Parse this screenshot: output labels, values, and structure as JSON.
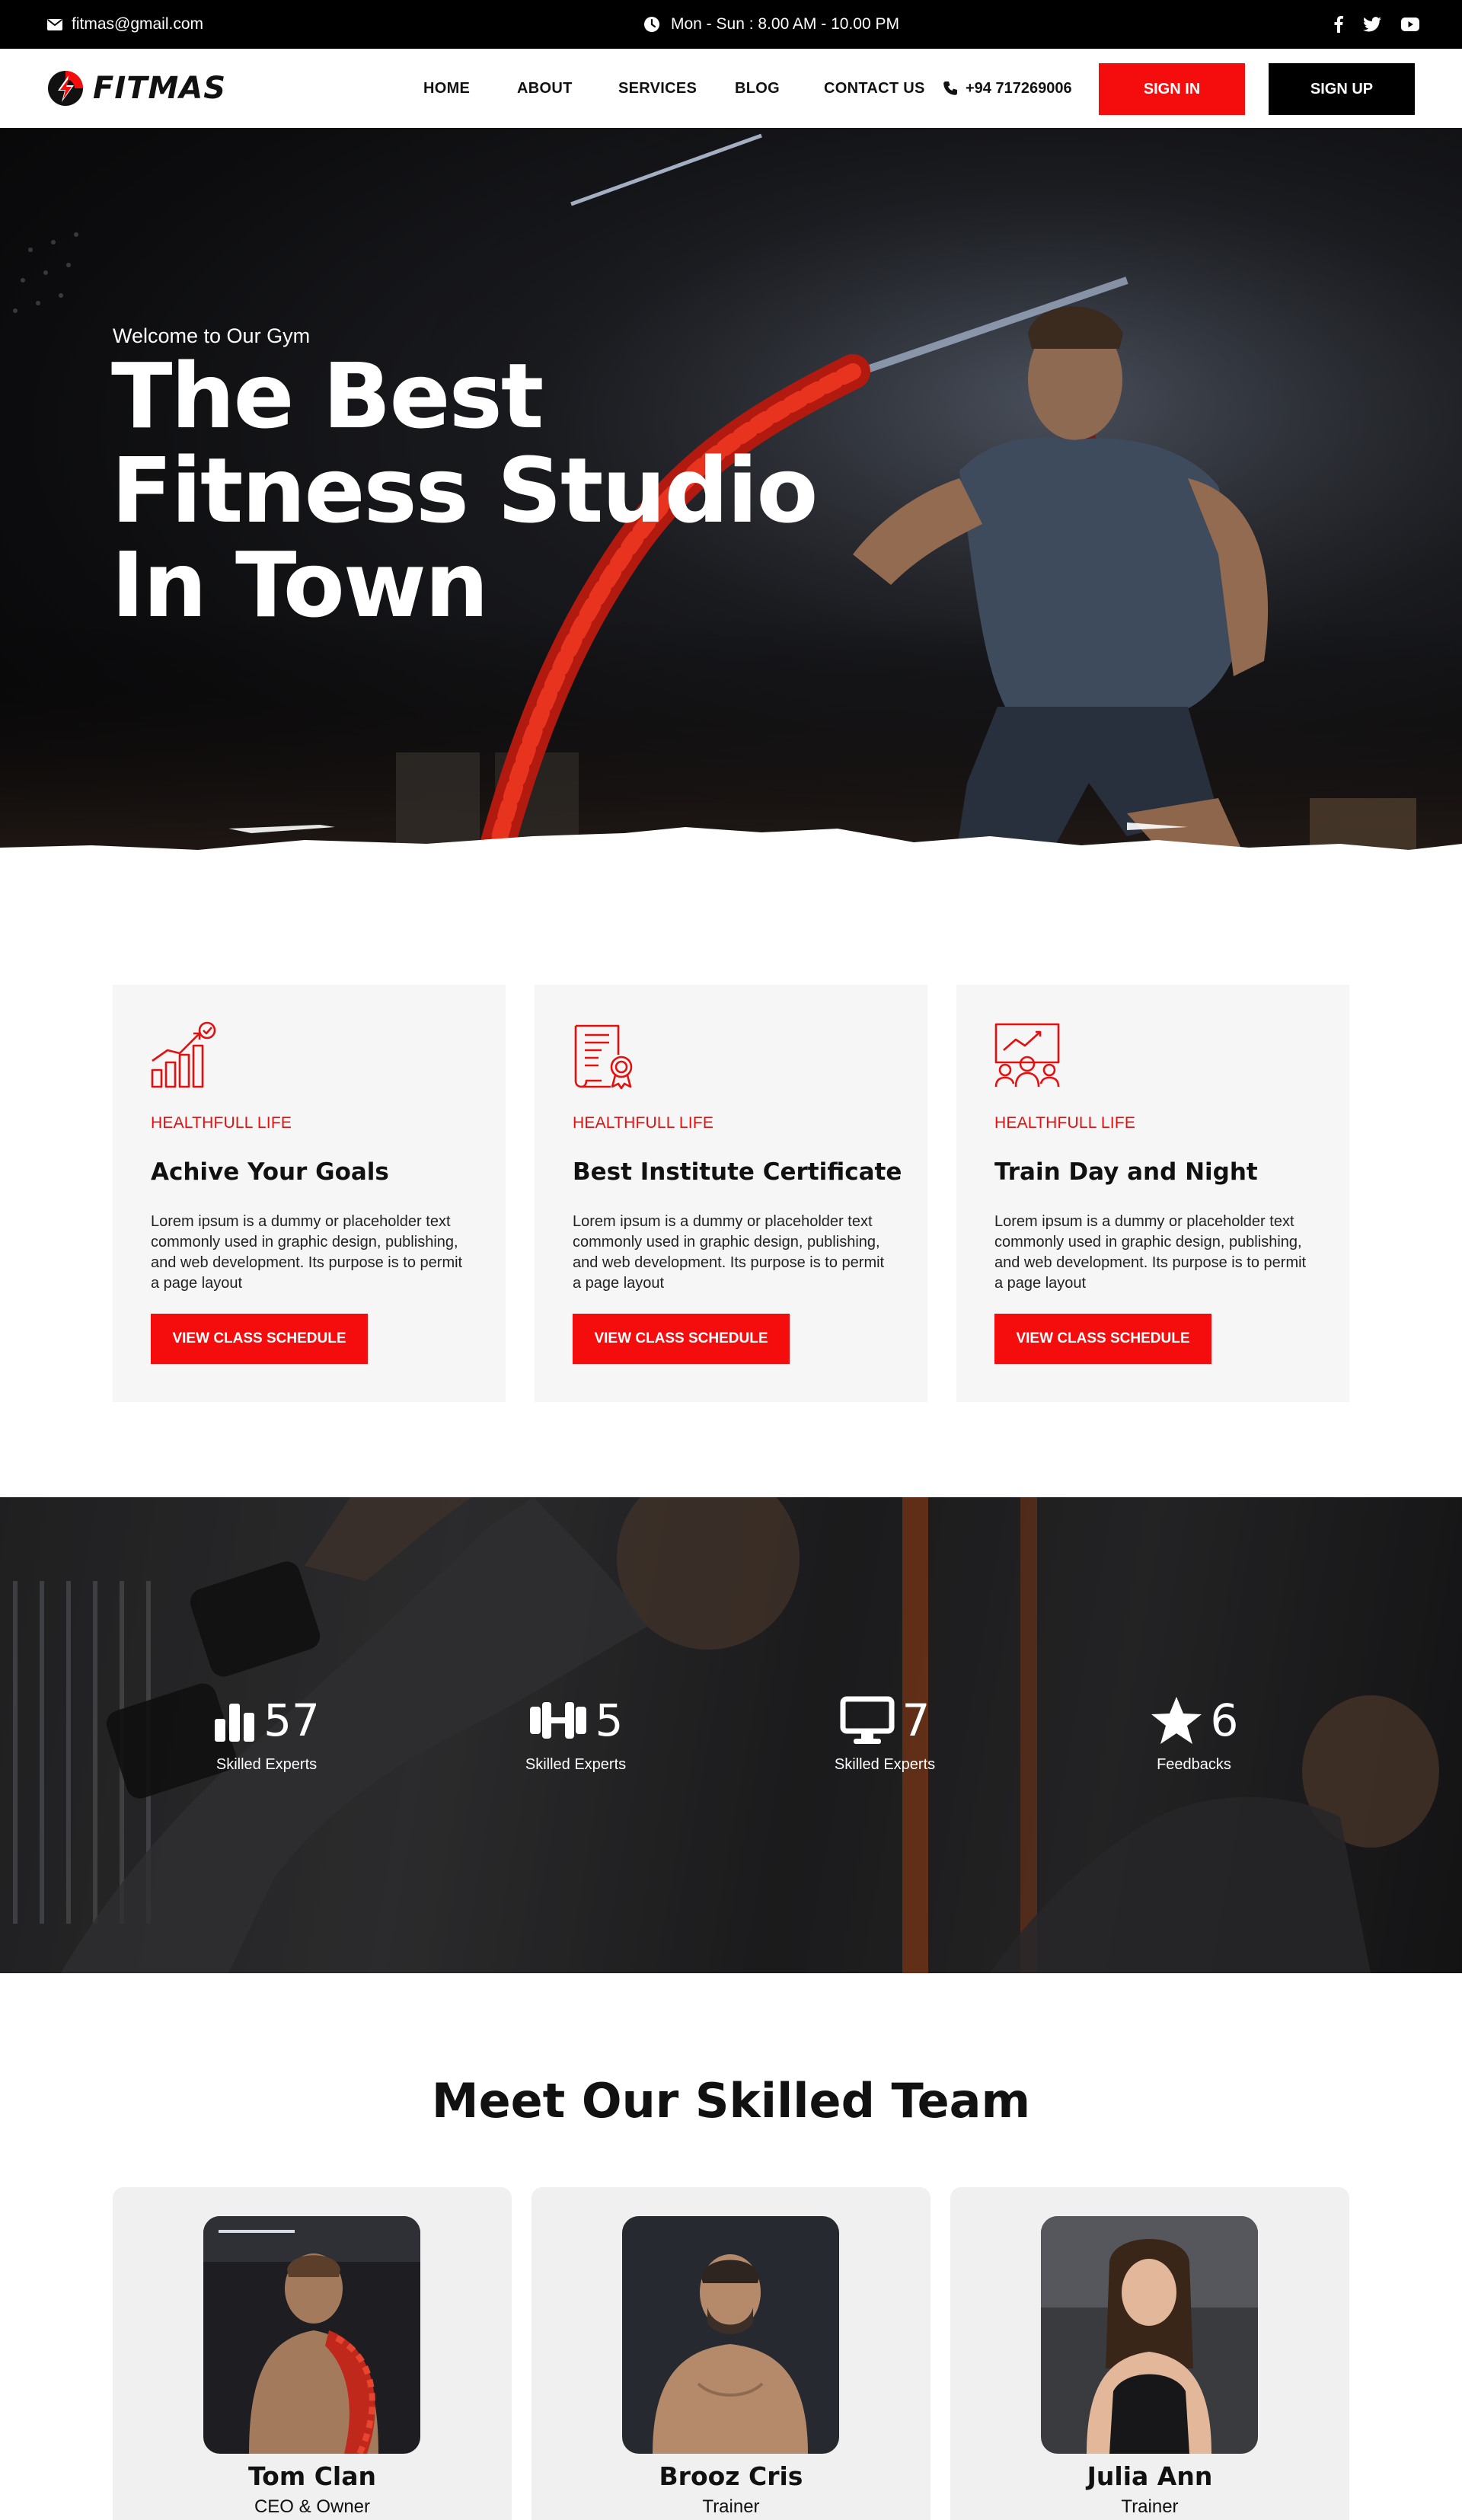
{
  "topbar": {
    "email": "fitmas@gmail.com",
    "hours": "Mon - Sun : 8.00 AM - 10.00 PM",
    "social": [
      "facebook-icon",
      "twitter-icon",
      "youtube-icon"
    ]
  },
  "nav": {
    "logo": "FITMAS",
    "links": [
      "HOME",
      "ABOUT",
      "SERVICES",
      "BLOG",
      "CONTACT US"
    ],
    "phone": "+94 717269006",
    "sign_in": "SIGN IN",
    "sign_up": "SIGN UP"
  },
  "hero": {
    "subtitle": "Welcome to Our Gym",
    "title_lines": [
      "The Best",
      "Fitness Studio",
      "In Town"
    ]
  },
  "features": [
    {
      "icon": "growth-chart-icon",
      "tag": "HEALTHFULL LIFE",
      "title": "Achive Your Goals",
      "text": "Lorem ipsum is a dummy or placeholder text commonly used in graphic design, publishing, and web development. Its purpose is to permit a page layout",
      "button": "VIEW CLASS SCHEDULE"
    },
    {
      "icon": "certificate-icon",
      "tag": "HEALTHFULL LIFE",
      "title": "Best Institute Certificate",
      "text": "Lorem ipsum is a dummy or placeholder text commonly used in graphic design, publishing, and web development. Its purpose is to permit a page layout",
      "button": "VIEW CLASS SCHEDULE"
    },
    {
      "icon": "presentation-team-icon",
      "tag": "HEALTHFULL LIFE",
      "title": "Train Day and Night",
      "text": "Lorem ipsum is a dummy or placeholder text commonly used in graphic design, publishing, and web development. Its purpose is to permit a page layout",
      "button": "VIEW CLASS SCHEDULE"
    }
  ],
  "stats": [
    {
      "icon": "bar-chart-icon",
      "value": "57",
      "label": "Skilled Experts"
    },
    {
      "icon": "dumbbell-icon",
      "value": "5",
      "label": "Skilled Experts"
    },
    {
      "icon": "monitor-icon",
      "value": "7",
      "label": "Skilled Experts"
    },
    {
      "icon": "star-icon",
      "value": "6",
      "label": "Feedbacks"
    }
  ],
  "team": {
    "title": "Meet Our Skilled Team",
    "members": [
      {
        "name": "Tom Clan",
        "role": "CEO & Owner"
      },
      {
        "name": "Brooz Cris",
        "role": "Trainer"
      },
      {
        "name": "Julia Ann",
        "role": "Trainer"
      }
    ]
  },
  "colors": {
    "accent": "#f50d0d",
    "dark": "#000000",
    "card_bg": "#f6f6f6"
  }
}
